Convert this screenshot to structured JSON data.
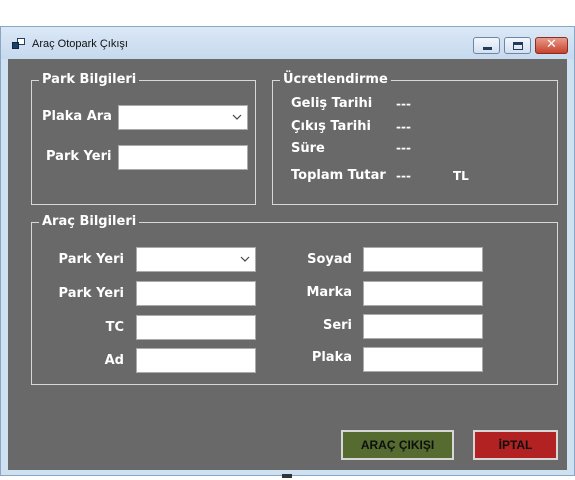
{
  "window": {
    "title": "Araç Otopark Çıkışı",
    "close_glyph": "✕"
  },
  "park_bilgileri": {
    "title": "Park Bilgileri",
    "plaka_ara_label": "Plaka Ara",
    "plaka_ara_value": "",
    "park_yeri_label": "Park Yeri",
    "park_yeri_value": ""
  },
  "ucretlendirme": {
    "title": "Ücretlendirme",
    "gelis_label": "Geliş Tarihi",
    "gelis_value": "---",
    "cikis_label": "Çıkış Tarihi",
    "cikis_value": "---",
    "sure_label": "Süre",
    "sure_value": "---",
    "toplam_label": "Toplam Tutar",
    "toplam_value": "---",
    "currency": "TL"
  },
  "arac_bilgileri": {
    "title": "Araç Bilgileri",
    "park_yeri_select_label": "Park Yeri",
    "park_yeri_select_value": "",
    "park_yeri_label": "Park Yeri",
    "park_yeri_value": "",
    "tc_label": "TC",
    "tc_value": "",
    "ad_label": "Ad",
    "ad_value": "",
    "soyad_label": "Soyad",
    "soyad_value": "",
    "marka_label": "Marka",
    "marka_value": "",
    "seri_label": "Seri",
    "seri_value": "",
    "plaka_label": "Plaka",
    "plaka_value": ""
  },
  "buttons": {
    "arac_cikisi": "ARAÇ ÇIKIŞI",
    "iptal": "İPTAL"
  },
  "colors": {
    "client_bg": "#696969",
    "accept_button": "#556b2f",
    "cancel_button": "#b22222"
  }
}
